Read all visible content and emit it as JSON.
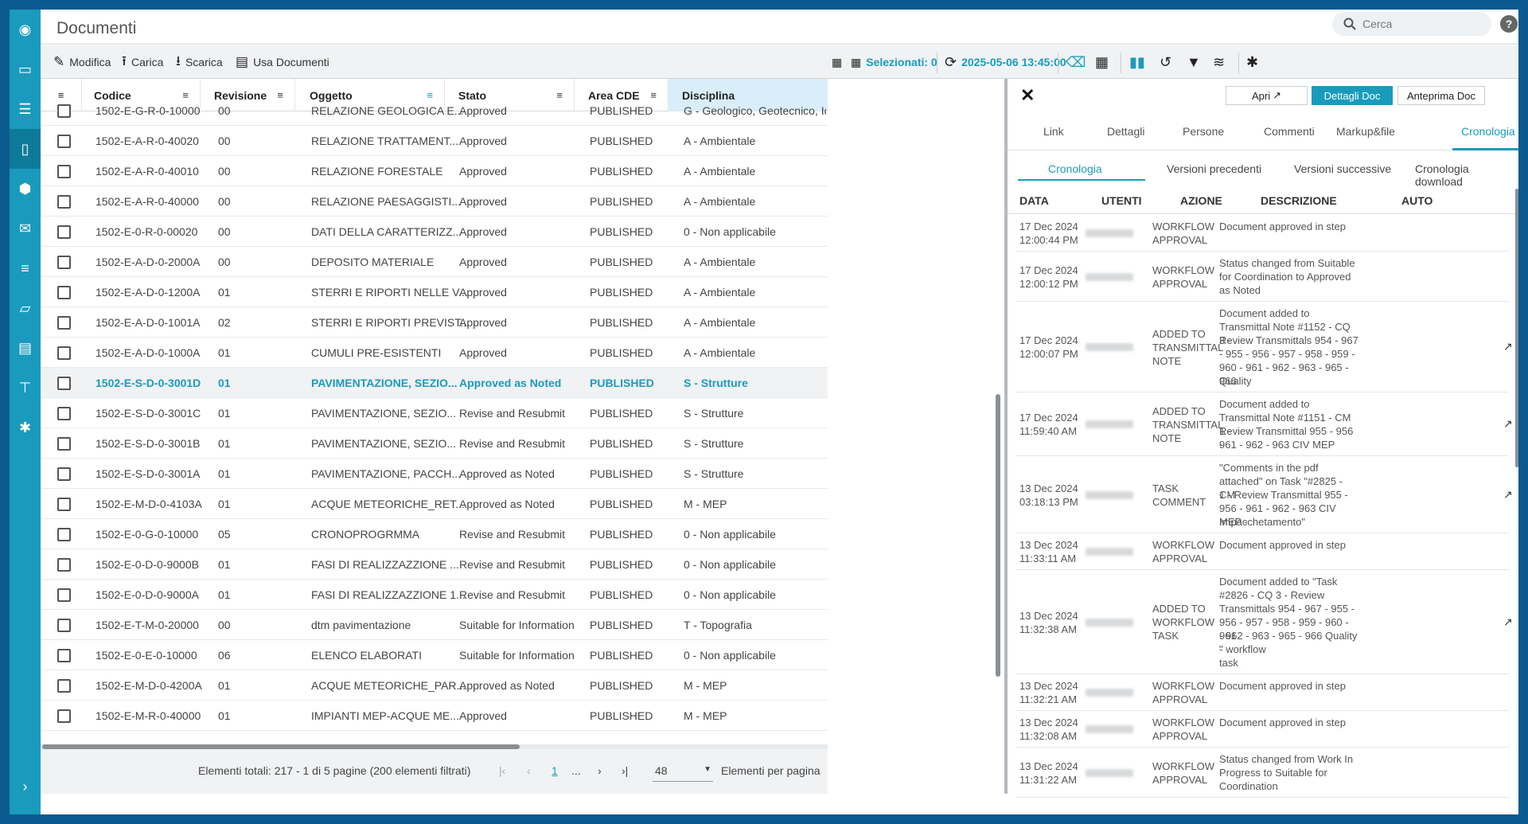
{
  "header": {
    "title": "Documenti",
    "search_placeholder": "Cerca",
    "help": "?"
  },
  "sidebar": {
    "items": [
      {
        "icon": "dashboard-icon",
        "glyph": "◉"
      },
      {
        "icon": "chat-icon",
        "glyph": "▭"
      },
      {
        "icon": "list-icon",
        "glyph": "☰"
      },
      {
        "icon": "document-icon",
        "glyph": "▯"
      },
      {
        "icon": "package-icon",
        "glyph": "⬢"
      },
      {
        "icon": "mail-icon",
        "glyph": "✉"
      },
      {
        "icon": "stack-icon",
        "glyph": "≡"
      },
      {
        "icon": "folder-icon",
        "glyph": "▱"
      },
      {
        "icon": "file-icon",
        "glyph": "▤"
      },
      {
        "icon": "org-chart-icon",
        "glyph": "⊤"
      },
      {
        "icon": "settings-icon",
        "glyph": "✱"
      }
    ],
    "expand": "›"
  },
  "toolbar": {
    "modifica": "Modifica",
    "carica": "Carica",
    "scarica": "Scarica",
    "usa": "Usa Documenti",
    "selezionati": "Selezionati: 0",
    "timestamp": "2025-05-06 13:45:00"
  },
  "columns": [
    "Codice",
    "Revisione",
    "Oggetto",
    "Stato",
    "Area CDE",
    "Disciplina"
  ],
  "rows": [
    [
      "1502-E-G-R-0-10000",
      "00",
      "RELAZIONE GEOLOGICA E...",
      "Approved",
      "PUBLISHED",
      "G - Geologico, Geotecnico, Idrogeologico"
    ],
    [
      "1502-E-A-R-0-40020",
      "00",
      "RELAZIONE TRATTAMENT...",
      "Approved",
      "PUBLISHED",
      "A - Ambientale"
    ],
    [
      "1502-E-A-R-0-40010",
      "00",
      "RELAZIONE FORESTALE",
      "Approved",
      "PUBLISHED",
      "A - Ambientale"
    ],
    [
      "1502-E-A-R-0-40000",
      "00",
      "RELAZIONE PAESAGGISTI...",
      "Approved",
      "PUBLISHED",
      "A - Ambientale"
    ],
    [
      "1502-E-0-R-0-00020",
      "00",
      "DATI DELLA CARATTERIZZ...",
      "Approved",
      "PUBLISHED",
      "0 - Non applicabile"
    ],
    [
      "1502-E-A-D-0-2000A",
      "00",
      "DEPOSITO MATERIALE",
      "Approved",
      "PUBLISHED",
      "A - Ambientale"
    ],
    [
      "1502-E-A-D-0-1200A",
      "01",
      "STERRI E RIPORTI NELLE V...",
      "Approved",
      "PUBLISHED",
      "A - Ambientale"
    ],
    [
      "1502-E-A-D-0-1001A",
      "02",
      "STERRI E RIPORTI PREVIST...",
      "Approved",
      "PUBLISHED",
      "A - Ambientale"
    ],
    [
      "1502-E-A-D-0-1000A",
      "01",
      "CUMULI PRE-ESISTENTI",
      "Approved",
      "PUBLISHED",
      "A - Ambientale"
    ],
    [
      "1502-E-S-D-0-3001D",
      "01",
      "PAVIMENTAZIONE, SEZIO...",
      "Approved as Noted",
      "PUBLISHED",
      "S - Strutture"
    ],
    [
      "1502-E-S-D-0-3001C",
      "01",
      "PAVIMENTAZIONE, SEZIO...",
      "Revise and Resubmit",
      "PUBLISHED",
      "S - Strutture"
    ],
    [
      "1502-E-S-D-0-3001B",
      "01",
      "PAVIMENTAZIONE, SEZIO...",
      "Revise and Resubmit",
      "PUBLISHED",
      "S - Strutture"
    ],
    [
      "1502-E-S-D-0-3001A",
      "01",
      "PAVIMENTAZIONE, PACCH...",
      "Approved as Noted",
      "PUBLISHED",
      "S - Strutture"
    ],
    [
      "1502-E-M-D-0-4103A",
      "01",
      "ACQUE METEORICHE_RET...",
      "Approved as Noted",
      "PUBLISHED",
      "M - MEP"
    ],
    [
      "1502-E-0-G-0-10000",
      "05",
      "CRONOPROGRMMA",
      "Revise and Resubmit",
      "PUBLISHED",
      "0 - Non applicabile"
    ],
    [
      "1502-E-0-D-0-9000B",
      "01",
      "FASI DI REALIZZAZZIONE ...",
      "Revise and Resubmit",
      "PUBLISHED",
      "0 - Non applicabile"
    ],
    [
      "1502-E-0-D-0-9000A",
      "01",
      "FASI DI REALIZZAZZIONE 1...",
      "Revise and Resubmit",
      "PUBLISHED",
      "0 - Non applicabile"
    ],
    [
      "1502-E-T-M-0-20000",
      "00",
      "dtm pavimentazione",
      "Suitable for Information",
      "PUBLISHED",
      "T - Topografia"
    ],
    [
      "1502-E-0-E-0-10000",
      "06",
      "ELENCO ELABORATI",
      "Suitable for Information",
      "PUBLISHED",
      "0 - Non applicabile"
    ],
    [
      "1502-E-M-D-0-4200A",
      "01",
      "ACQUE METEORICHE_PAR...",
      "Approved as Noted",
      "PUBLISHED",
      "M - MEP"
    ],
    [
      "1502-E-M-R-0-40000",
      "01",
      "IMPIANTI MEP-ACQUE ME...",
      "Approved",
      "PUBLISHED",
      "M - MEP"
    ]
  ],
  "highlighted_row": 9,
  "pager": {
    "summary": "Elementi totali: 217 - 1 di 5 pagine (200 elementi filtrati)",
    "first": "|‹",
    "prev": "‹",
    "page": "1",
    "ellipsis": "...",
    "next": "›",
    "last": "›|",
    "per_page": "48",
    "per_page_label": "Elementi per pagina"
  },
  "panel": {
    "apri": "Apri",
    "dettagli_doc": "Dettagli Doc",
    "anteprima": "Anteprima Doc",
    "tabs": [
      "Link",
      "Dettagli",
      "Persone",
      "Commenti",
      "Markup&file",
      "Cronologia"
    ],
    "subtabs": [
      "Cronologia",
      "Versioni precedenti",
      "Versioni successive",
      "Cronologia download"
    ],
    "history_columns": [
      "DATA",
      "UTENTI",
      "AZIONE",
      "DESCRIZIONE",
      "AUTO"
    ],
    "history": [
      {
        "date": [
          "17 Dec 2024",
          "12:00:44 PM"
        ],
        "action": [
          "WORKFLOW",
          "APPROVAL"
        ],
        "desc": [
          "Document approved in step",
          ""
        ],
        "ext": false
      },
      {
        "date": [
          "17 Dec 2024",
          "12:00:12 PM"
        ],
        "action": [
          "WORKFLOW",
          "APPROVAL"
        ],
        "desc": [
          "Status changed from Suitable",
          "for Coordination to Approved",
          "as Noted"
        ],
        "ext": false
      },
      {
        "date": [
          "17 Dec 2024",
          "12:00:07 PM"
        ],
        "action": [
          "ADDED TO",
          "TRANSMITTAL",
          "NOTE"
        ],
        "desc": [
          "Document added to",
          "Transmittal Note #1152 - CQ 3 -",
          "Review Transmittals 954 - 967",
          "- 955 - 956 - 957 - 958 - 959 -",
          "960 - 961 - 962 - 963 - 965 - 966",
          "Quality"
        ],
        "ext": true
      },
      {
        "date": [
          "17 Dec 2024",
          "11:59:40 AM"
        ],
        "action": [
          "ADDED TO",
          "TRANSMITTAL",
          "NOTE"
        ],
        "desc": [
          "Document added to",
          "Transmittal Note #1151 - CM 1 -",
          "Review Transmittal 955 - 956 -",
          "961 - 962 - 963 CIV MEP"
        ],
        "ext": true
      },
      {
        "date": [
          "13 Dec 2024",
          "03:18:13 PM"
        ],
        "action": [
          "TASK",
          "COMMENT"
        ],
        "desc": [
          "\"Comments in the pdf",
          "attached\" on Task \"#2825 - CM",
          "1 - Review Transmittal 955 -",
          "956 - 961 - 962 - 963 CIV MEP -",
          "Impacchetamento\""
        ],
        "ext": true
      },
      {
        "date": [
          "13 Dec 2024",
          "11:33:11 AM"
        ],
        "action": [
          "WORKFLOW",
          "APPROVAL"
        ],
        "desc": [
          "Document approved in step",
          ""
        ],
        "ext": false
      },
      {
        "date": [
          "13 Dec 2024",
          "11:32:38 AM"
        ],
        "action": [
          "ADDED TO",
          "WORKFLOW",
          "TASK"
        ],
        "desc": [
          "Document added to \"Task",
          "#2826 - CQ 3 - Review",
          "Transmittals 954 - 967 - 955 -",
          "956 - 957 - 958 - 959 - 960 - 961",
          "- 962 - 963 - 965 - 966 Quality -",
          "\" workflow",
          "task"
        ],
        "ext": true
      },
      {
        "date": [
          "13 Dec 2024",
          "11:32:21 AM"
        ],
        "action": [
          "WORKFLOW",
          "APPROVAL"
        ],
        "desc": [
          "Document approved in step",
          ""
        ],
        "ext": false
      },
      {
        "date": [
          "13 Dec 2024",
          "11:32:08 AM"
        ],
        "action": [
          "WORKFLOW",
          "APPROVAL"
        ],
        "desc": [
          "Document approved in step",
          ""
        ],
        "ext": false
      },
      {
        "date": [
          "13 Dec 2024",
          "11:31:22 AM"
        ],
        "action": [
          "WORKFLOW",
          "APPROVAL"
        ],
        "desc": [
          "Status changed from Work In",
          "Progress to Suitable for",
          "Coordination"
        ],
        "ext": false
      }
    ]
  },
  "colors": {
    "accent": "#1a9bbd",
    "sidebar": "#1a9bbd",
    "frame": "#0b5a8f"
  }
}
